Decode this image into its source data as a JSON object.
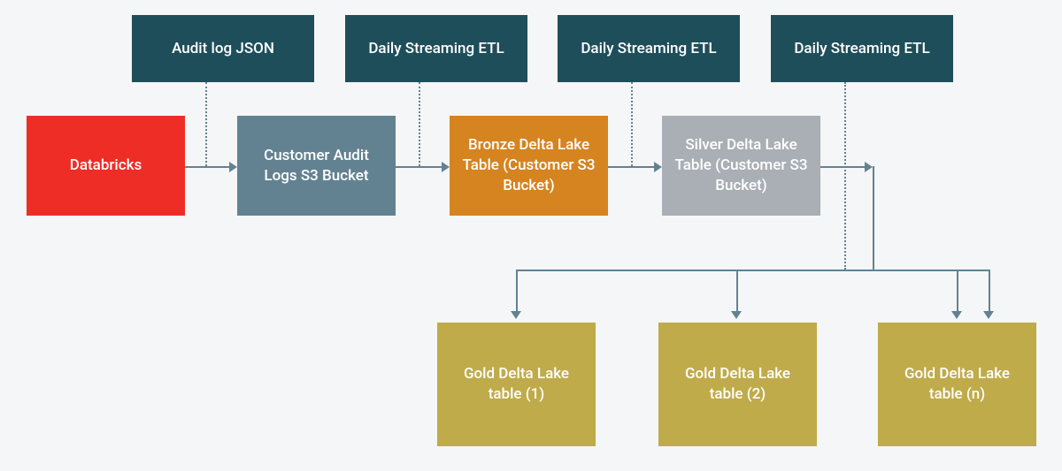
{
  "labels": {
    "audit_json": "Audit log JSON",
    "etl1": "Daily Streaming ETL",
    "etl2": "Daily Streaming ETL",
    "etl3": "Daily Streaming ETL"
  },
  "nodes": {
    "databricks": "Databricks",
    "customer_logs": "Customer Audit Logs S3 Bucket",
    "bronze": "Bronze\nDelta Lake Table (Customer S3 Bucket)",
    "silver": "Silver\nDelta Lake Table (Customer S3 Bucket)",
    "gold1": "Gold Delta Lake table (1)",
    "gold2": "Gold Delta Lake table (2)",
    "goldn": "Gold Delta Lake table (n)"
  },
  "colors": {
    "label": "#1f4e5b",
    "red": "#ee2d27",
    "slate": "#638291",
    "orange": "#d58420",
    "grey": "#a9afb4",
    "gold": "#c0ab4a"
  }
}
